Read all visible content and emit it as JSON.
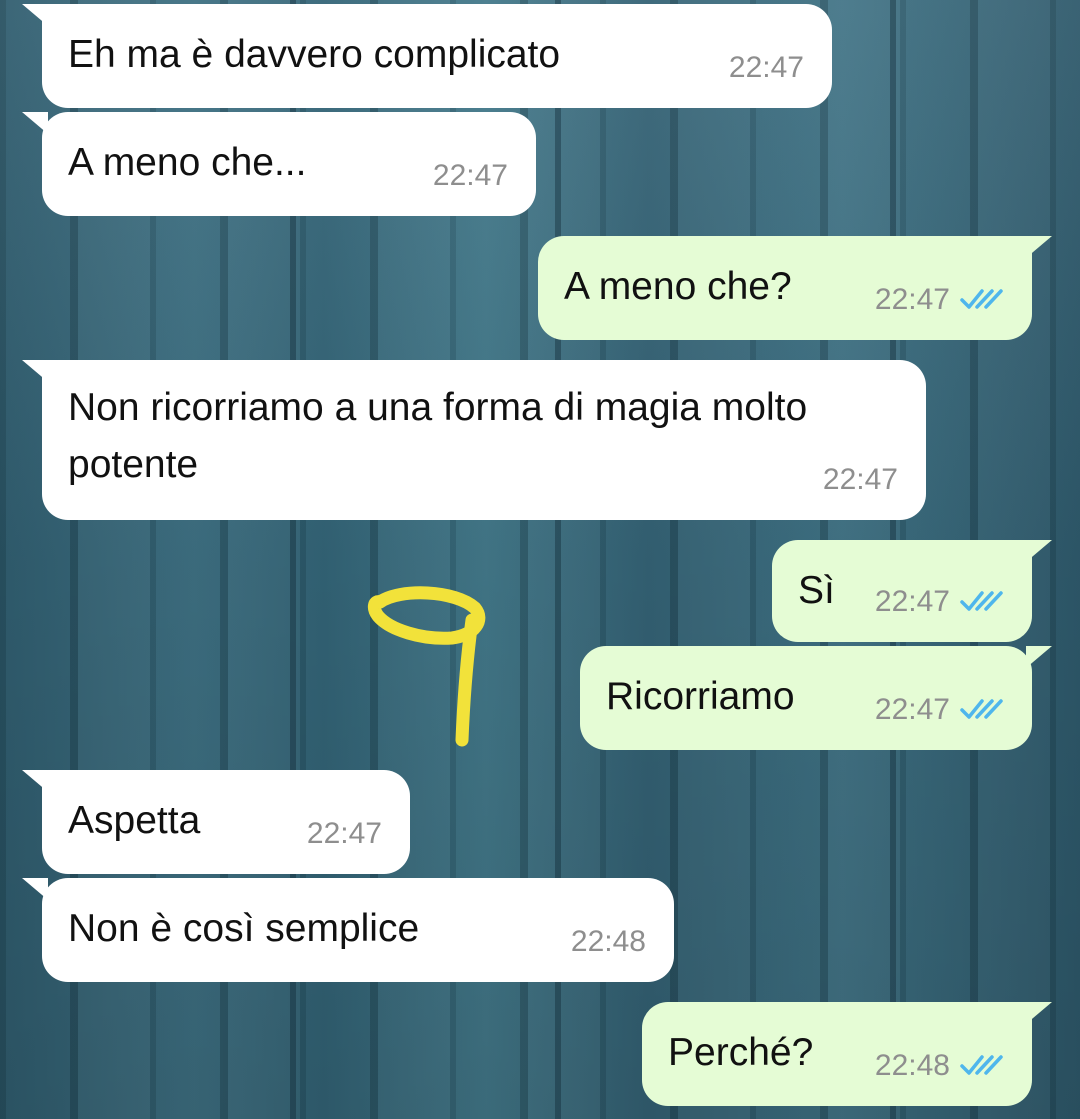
{
  "chat": {
    "messages": [
      {
        "direction": "incoming",
        "text": "Eh ma è davvero complicato",
        "time": "22:47"
      },
      {
        "direction": "incoming",
        "text": "A meno che...",
        "time": "22:47"
      },
      {
        "direction": "outgoing",
        "text": "A meno che?",
        "time": "22:47",
        "status": "read"
      },
      {
        "direction": "incoming",
        "text": "Non ricorriamo a una forma di magia molto potente",
        "time": "22:47"
      },
      {
        "direction": "outgoing",
        "text": "Sì",
        "time": "22:47",
        "status": "read"
      },
      {
        "direction": "outgoing",
        "text": "Ricorriamo",
        "time": "22:47",
        "status": "read"
      },
      {
        "direction": "incoming",
        "text": "Aspetta",
        "time": "22:47"
      },
      {
        "direction": "incoming",
        "text": "Non è così semplice",
        "time": "22:48"
      },
      {
        "direction": "outgoing",
        "text": "Perché?",
        "time": "22:48",
        "status": "read"
      }
    ]
  },
  "colors": {
    "incoming_bubble": "#ffffff",
    "outgoing_bubble": "#e5fcd5",
    "timestamp": "#8e8e8e",
    "read_ticks": "#4fb6ec",
    "doodle": "#f2e23a",
    "wallpaper": "#3a6d80"
  },
  "icons": {
    "read_receipt": "double-check-icon",
    "annotation": "hand-drawn-nine-doodle"
  }
}
